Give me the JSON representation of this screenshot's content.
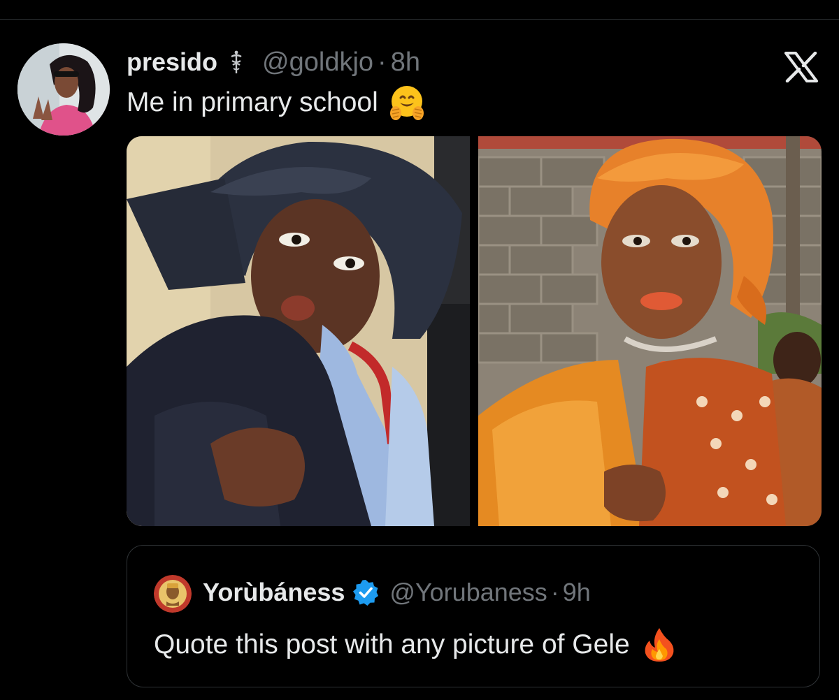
{
  "post": {
    "display_name": "presido",
    "name_badge_icon": "caduceus-icon",
    "handle": "@goldkjo",
    "separator": "·",
    "time": "8h",
    "text": "Me in primary school",
    "emoji": "hugging-face-emoji",
    "photos": [
      {
        "description_icon": "photo-left",
        "palette": "navy-gele"
      },
      {
        "description_icon": "photo-right",
        "palette": "orange-gele"
      }
    ]
  },
  "header": {
    "close_icon": "x-logo-icon"
  },
  "quote": {
    "display_name": "Yorùbáness",
    "verified_icon": "verified-badge-icon",
    "handle": "@Yorubaness",
    "separator": "·",
    "time": "9h",
    "text": "Quote this post with any picture of Gele",
    "emoji": "fire-emoji"
  },
  "colors": {
    "background": "#000000",
    "primary_text": "#e7e9ea",
    "secondary_text": "#71767b",
    "border": "#2f3336",
    "verified_blue": "#1d9bf0"
  }
}
